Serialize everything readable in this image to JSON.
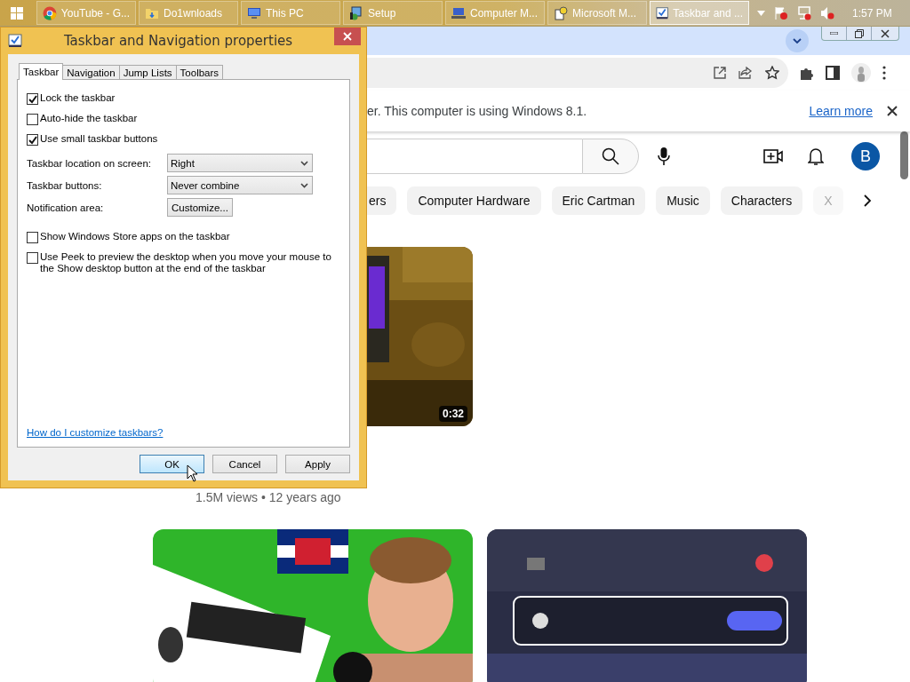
{
  "taskbar": {
    "buttons": [
      {
        "kind": "browser",
        "label": "YouTube - G...",
        "selected": false
      },
      {
        "kind": "folder",
        "label": "Do1wnloads",
        "selected": false
      },
      {
        "kind": "pc",
        "label": "This PC",
        "selected": false
      },
      {
        "kind": "setup",
        "label": "Setup",
        "selected": false
      },
      {
        "kind": "management",
        "label": "Computer M...",
        "selected": false
      },
      {
        "kind": "help",
        "label": "Microsoft M...",
        "selected": false
      },
      {
        "kind": "settings",
        "label": "Taskbar and ...",
        "selected": true
      }
    ],
    "clock": "1:57 PM"
  },
  "browser": {
    "infobar": {
      "message": "er. This computer is using Windows 8.1.",
      "link": "Learn more"
    },
    "youtube": {
      "avatar": "B",
      "chips": [
        {
          "label": "ers",
          "faded": false
        },
        {
          "label": "Computer Hardware",
          "faded": false
        },
        {
          "label": "Eric Cartman",
          "faded": false
        },
        {
          "label": "Music",
          "faded": false
        },
        {
          "label": "Characters",
          "faded": false
        },
        {
          "label": "X",
          "faded": true
        }
      ],
      "video": {
        "duration": "0:32",
        "meta": "1.5M views • 12 years ago"
      }
    }
  },
  "dialog": {
    "title": "Taskbar and Navigation properties",
    "tabs": [
      {
        "label": "Taskbar",
        "selected": true
      },
      {
        "label": "Navigation",
        "selected": false
      },
      {
        "label": "Jump Lists",
        "selected": false
      },
      {
        "label": "Toolbars",
        "selected": false
      }
    ],
    "options": [
      {
        "kind": "checkbox",
        "label": "Lock the taskbar",
        "checked": true
      },
      {
        "kind": "checkbox",
        "label": "Auto-hide the taskbar",
        "checked": false
      },
      {
        "kind": "checkbox",
        "label": "Use small taskbar buttons",
        "checked": true
      },
      {
        "kind": "dropdown",
        "label": "Taskbar location on screen:",
        "value": "Right"
      },
      {
        "kind": "dropdown",
        "label": "Taskbar buttons:",
        "value": "Never combine"
      },
      {
        "kind": "button",
        "label": "Notification area:",
        "value": "Customize..."
      },
      {
        "kind": "checkbox",
        "label": "Show Windows Store apps on the taskbar",
        "checked": false
      },
      {
        "kind": "checkbox",
        "label": "Use Peek to preview the desktop when you move your mouse to the Show desktop button at the end of the taskbar",
        "checked": false
      }
    ],
    "help_link": "How do I customize taskbars?",
    "buttons": [
      {
        "label": "OK",
        "default": true
      },
      {
        "label": "Cancel",
        "default": false
      },
      {
        "label": "Apply",
        "default": false
      }
    ]
  }
}
